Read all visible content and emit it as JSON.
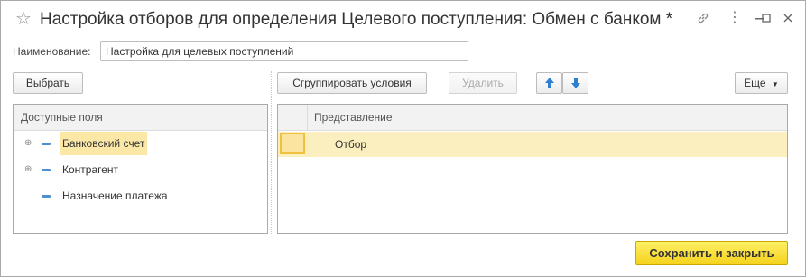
{
  "window": {
    "title": "Настройка отборов для определения Целевого поступления: Обмен с банком *",
    "star_icon": "star-icon",
    "link_icon": "link-icon",
    "menu_icon": "more-vertical-icon",
    "minimize_icon": "minimize-icon",
    "maximize_icon": "maximize-icon",
    "close_icon": "close-icon"
  },
  "name_field": {
    "label": "Наименование:",
    "value": "Настройка для целевых поступлений"
  },
  "left_toolbar": {
    "select_label": "Выбрать"
  },
  "right_toolbar": {
    "group_label": "Сгруппировать условия",
    "delete_label": "Удалить",
    "more_label": "Еще"
  },
  "available_fields": {
    "header": "Доступные поля",
    "items": [
      {
        "label": "Банковский счет",
        "expandable": true,
        "selected": true
      },
      {
        "label": "Контрагент",
        "expandable": true,
        "selected": false
      },
      {
        "label": "Назначение платежа",
        "expandable": false,
        "selected": false
      }
    ]
  },
  "filter_table": {
    "header": "Представление",
    "rows": [
      {
        "label": "Отбор",
        "selected": true
      }
    ]
  },
  "footer": {
    "save_label": "Сохранить и закрыть"
  },
  "colors": {
    "selection": "#fbe8a6",
    "accent_arrow": "#2f7fd1",
    "save_button": "#f5d21c"
  }
}
